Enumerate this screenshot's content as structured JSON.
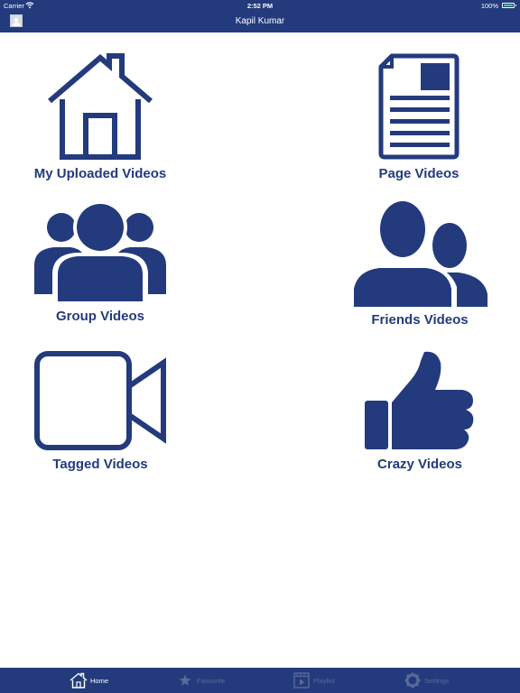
{
  "status_bar": {
    "carrier": "Carrier",
    "time": "2:52 PM",
    "battery": "100%"
  },
  "nav": {
    "title": "Kapil Kumar",
    "avatar_icon": "user-avatar-icon"
  },
  "menu": {
    "my_uploaded": {
      "label": "My Uploaded Videos",
      "icon": "house-icon"
    },
    "page_videos": {
      "label": "Page Videos",
      "icon": "document-icon"
    },
    "group_videos": {
      "label": "Group Videos",
      "icon": "group-icon"
    },
    "friends_videos": {
      "label": "Friends Videos",
      "icon": "friends-icon"
    },
    "tagged_videos": {
      "label": "Tagged Videos",
      "icon": "video-camera-icon"
    },
    "crazy_videos": {
      "label": "Crazy Videos",
      "icon": "thumbs-up-icon"
    }
  },
  "tabs": {
    "home": {
      "label": "Home",
      "icon": "home-icon",
      "active": true
    },
    "favourite": {
      "label": "Favourite",
      "icon": "star-icon",
      "active": false
    },
    "playlist": {
      "label": "Playlist",
      "icon": "film-icon",
      "active": false
    },
    "settings": {
      "label": "Settings",
      "icon": "gear-icon",
      "active": false
    }
  },
  "colors": {
    "brand": "#233a7d",
    "background": "#ffffff",
    "tab_inactive": "#5b6a99",
    "battery_fill": "#4cd964"
  }
}
